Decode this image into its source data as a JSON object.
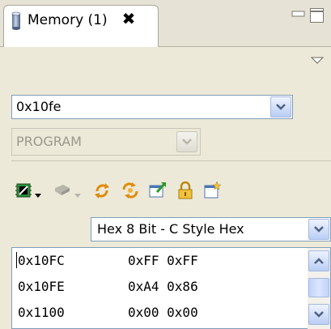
{
  "tab": {
    "title": "Memory (1)",
    "close_glyph": "✖"
  },
  "address": {
    "value": "0x10fe"
  },
  "memory_space": {
    "value": "PROGRAM"
  },
  "toolbar": {
    "items": [
      "chip-icon",
      "chip-dropdown",
      "chip2-icon",
      "chip2-dropdown",
      "refresh-icon",
      "refresh-all-icon",
      "export-icon",
      "lock-icon",
      "import-icon"
    ]
  },
  "format": {
    "value": "Hex 8 Bit - C Style Hex"
  },
  "rows": [
    {
      "address": "0x10FC",
      "bytes": "0xFF 0xFF"
    },
    {
      "address": "0x10FE",
      "bytes": "0xA4 0x86"
    },
    {
      "address": "0x1100",
      "bytes": "0x00 0x00"
    }
  ],
  "colors": {
    "accent": "#316ac5",
    "panel": "#ece9d8",
    "border": "#7f9db9"
  }
}
